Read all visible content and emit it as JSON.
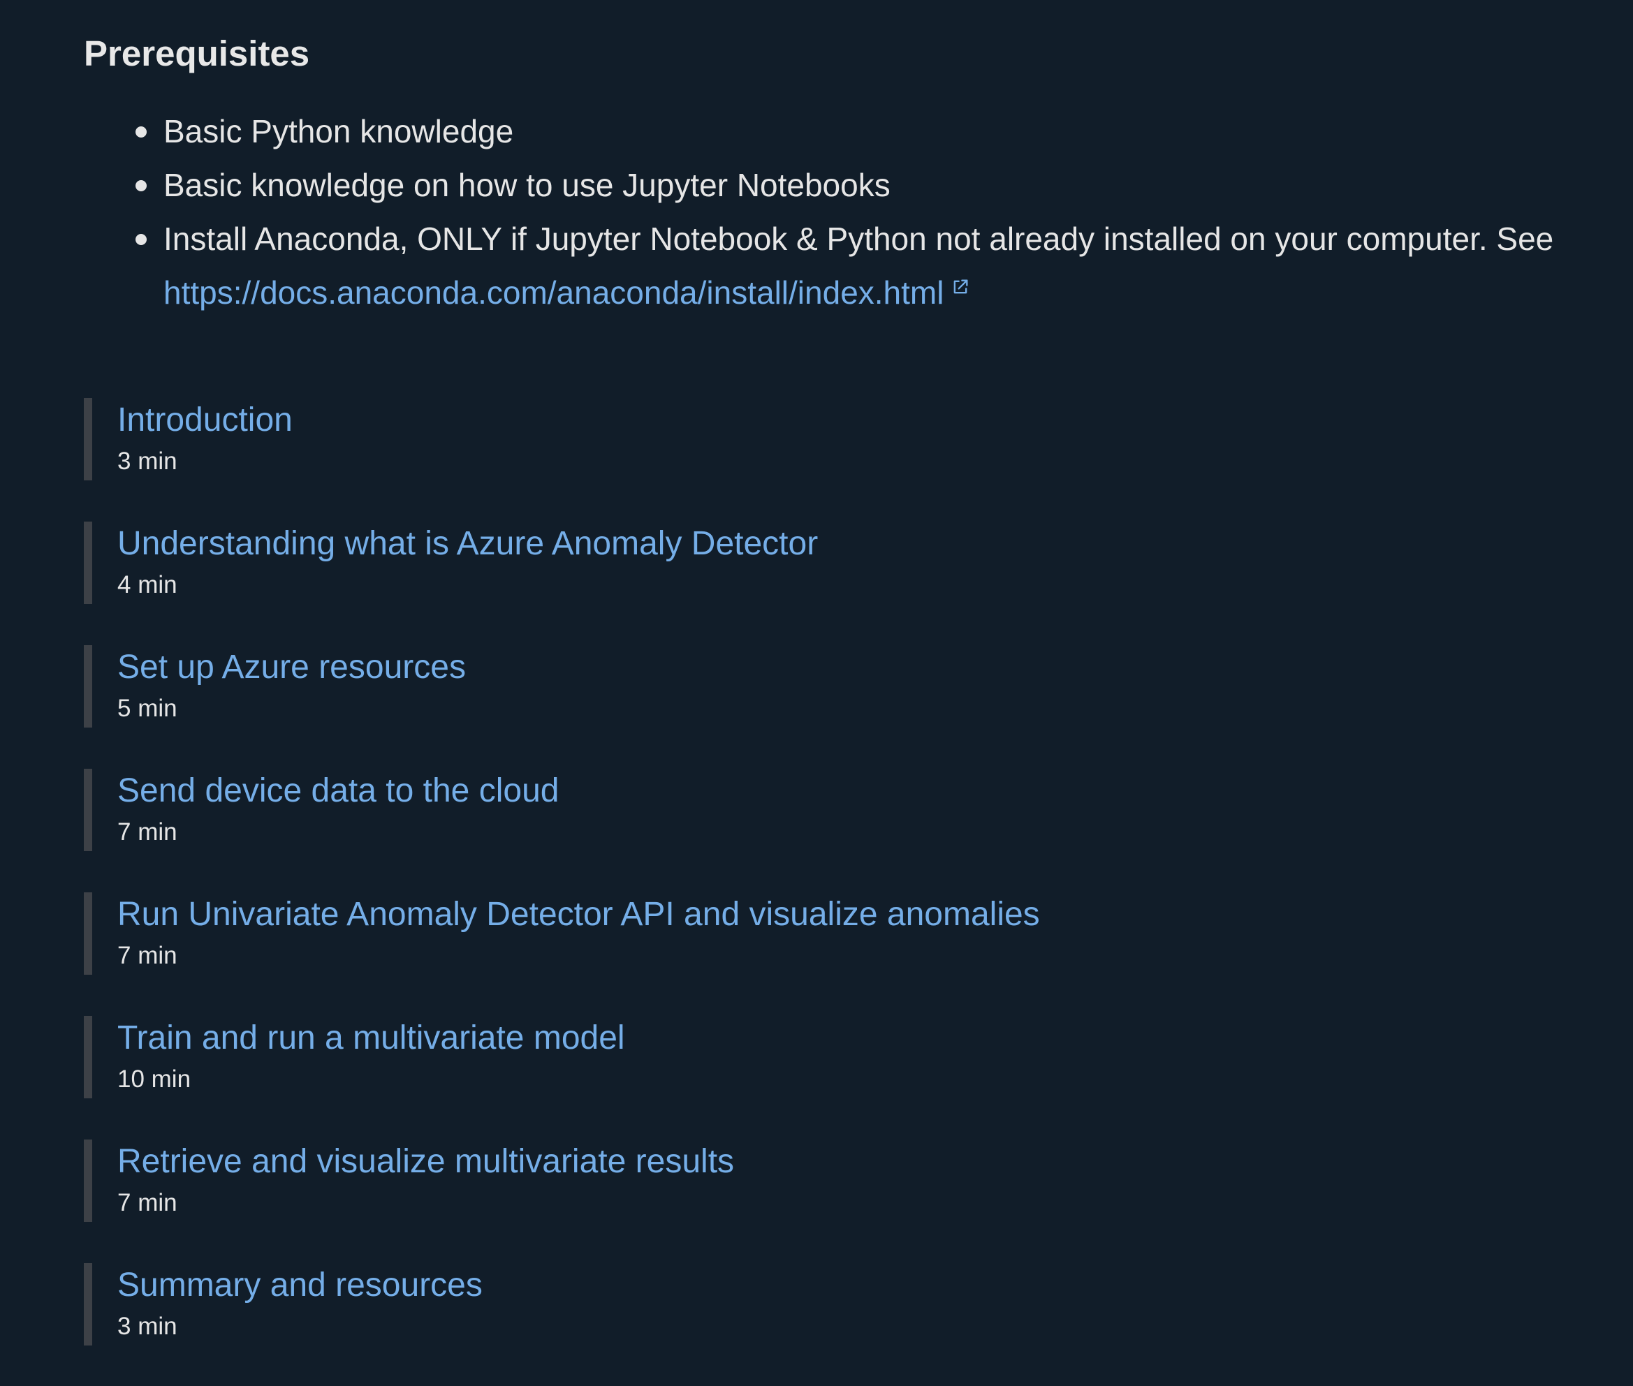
{
  "prerequisites": {
    "title": "Prerequisites",
    "items": [
      {
        "text": "Basic Python knowledge"
      },
      {
        "text": "Basic knowledge on how to use Jupyter Notebooks"
      },
      {
        "text": "Install Anaconda, ONLY if Jupyter Notebook & Python not already installed on your computer. See ",
        "link": "https://docs.anaconda.com/anaconda/install/index.html"
      }
    ]
  },
  "modules": [
    {
      "title": "Introduction",
      "duration": "3 min"
    },
    {
      "title": "Understanding what is Azure Anomaly Detector",
      "duration": "4 min"
    },
    {
      "title": "Set up Azure resources",
      "duration": "5 min"
    },
    {
      "title": "Send device data to the cloud",
      "duration": "7 min"
    },
    {
      "title": "Run Univariate Anomaly Detector API and visualize anomalies",
      "duration": "7 min"
    },
    {
      "title": "Train and run a multivariate model",
      "duration": "10 min"
    },
    {
      "title": "Retrieve and visualize multivariate results",
      "duration": "7 min"
    },
    {
      "title": "Summary and resources",
      "duration": "3 min"
    }
  ],
  "icons": {
    "external_link": "external-link-icon"
  },
  "colors": {
    "background": "#111d29",
    "link": "#75aee8",
    "text": "#e6e6e6",
    "module_bar": "#3d4147"
  }
}
